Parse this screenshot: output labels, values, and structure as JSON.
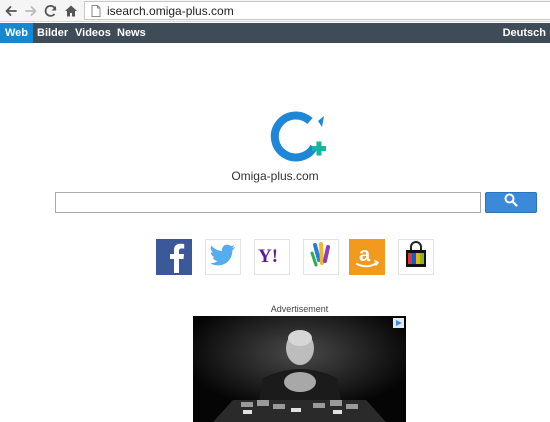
{
  "browser": {
    "url": "isearch.omiga-plus.com",
    "icons": [
      "back-arrow-icon",
      "forward-arrow-icon",
      "reload-icon",
      "home-icon",
      "page-icon"
    ]
  },
  "nav": {
    "tabs": [
      {
        "label": "Web",
        "active": true
      },
      {
        "label": "Bilder",
        "active": false
      },
      {
        "label": "Videos",
        "active": false
      },
      {
        "label": "News",
        "active": false
      }
    ],
    "language": "Deutsch"
  },
  "brand": {
    "name": "Omiga-plus.com",
    "colors": {
      "ring": "#1e88d6",
      "plus": "#14b5a5"
    }
  },
  "search": {
    "value": "",
    "button_icon": "search-icon"
  },
  "shortcuts": [
    {
      "name": "Facebook",
      "icon": "facebook-icon"
    },
    {
      "name": "Twitter",
      "icon": "twitter-icon"
    },
    {
      "name": "Yahoo",
      "icon": "yahoo-icon"
    },
    {
      "name": "Walmart",
      "icon": "walmart-icon"
    },
    {
      "name": "Amazon",
      "icon": "amazon-icon"
    },
    {
      "name": "eBay",
      "icon": "shopping-bag-icon"
    }
  ],
  "advertisement": {
    "label": "Advertisement"
  },
  "colors": {
    "nav_bg": "#3f4b57",
    "active_tab": "#1687d1",
    "search_button": "#3b8ad9"
  }
}
